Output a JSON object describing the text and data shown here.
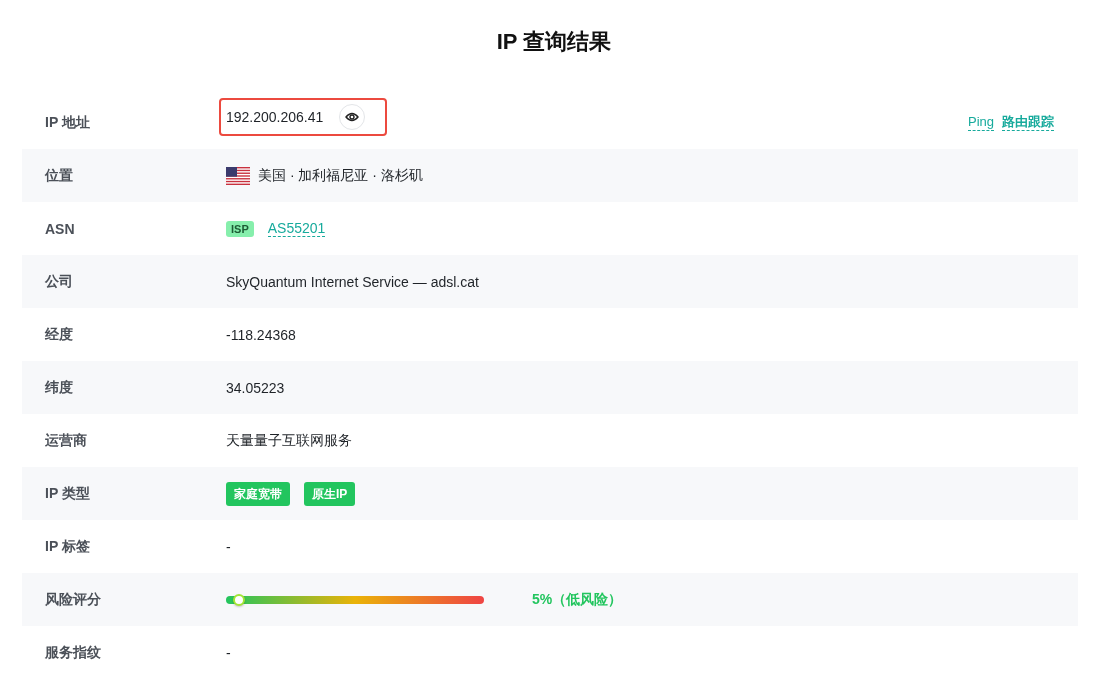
{
  "title": "IP 查询结果",
  "rows": [
    {
      "kind": "ip",
      "label": "IP 地址",
      "value": "192.200.206.41",
      "highlighted": true,
      "links": [
        "Ping",
        "路由跟踪"
      ]
    },
    {
      "kind": "location",
      "label": "位置",
      "value": "美国 · 加利福尼亚 · 洛杉矶"
    },
    {
      "kind": "asn",
      "label": "ASN",
      "badge": "ISP",
      "value": "AS55201"
    },
    {
      "kind": "text",
      "label": "公司",
      "value": "SkyQuantum Internet Service — adsl.cat"
    },
    {
      "kind": "text",
      "label": "经度",
      "value": "-118.24368"
    },
    {
      "kind": "text",
      "label": "纬度",
      "value": "34.05223"
    },
    {
      "kind": "text",
      "label": "运营商",
      "value": "天量量子互联网服务"
    },
    {
      "kind": "tags",
      "label": "IP 类型",
      "tags": [
        "家庭宽带",
        "原生IP"
      ]
    },
    {
      "kind": "text",
      "label": "IP 标签",
      "value": "-"
    },
    {
      "kind": "risk",
      "label": "风险评分",
      "level": 0.05,
      "reading": "5%（低风险）"
    },
    {
      "kind": "text",
      "label": "服务指纹",
      "value": "-"
    }
  ]
}
